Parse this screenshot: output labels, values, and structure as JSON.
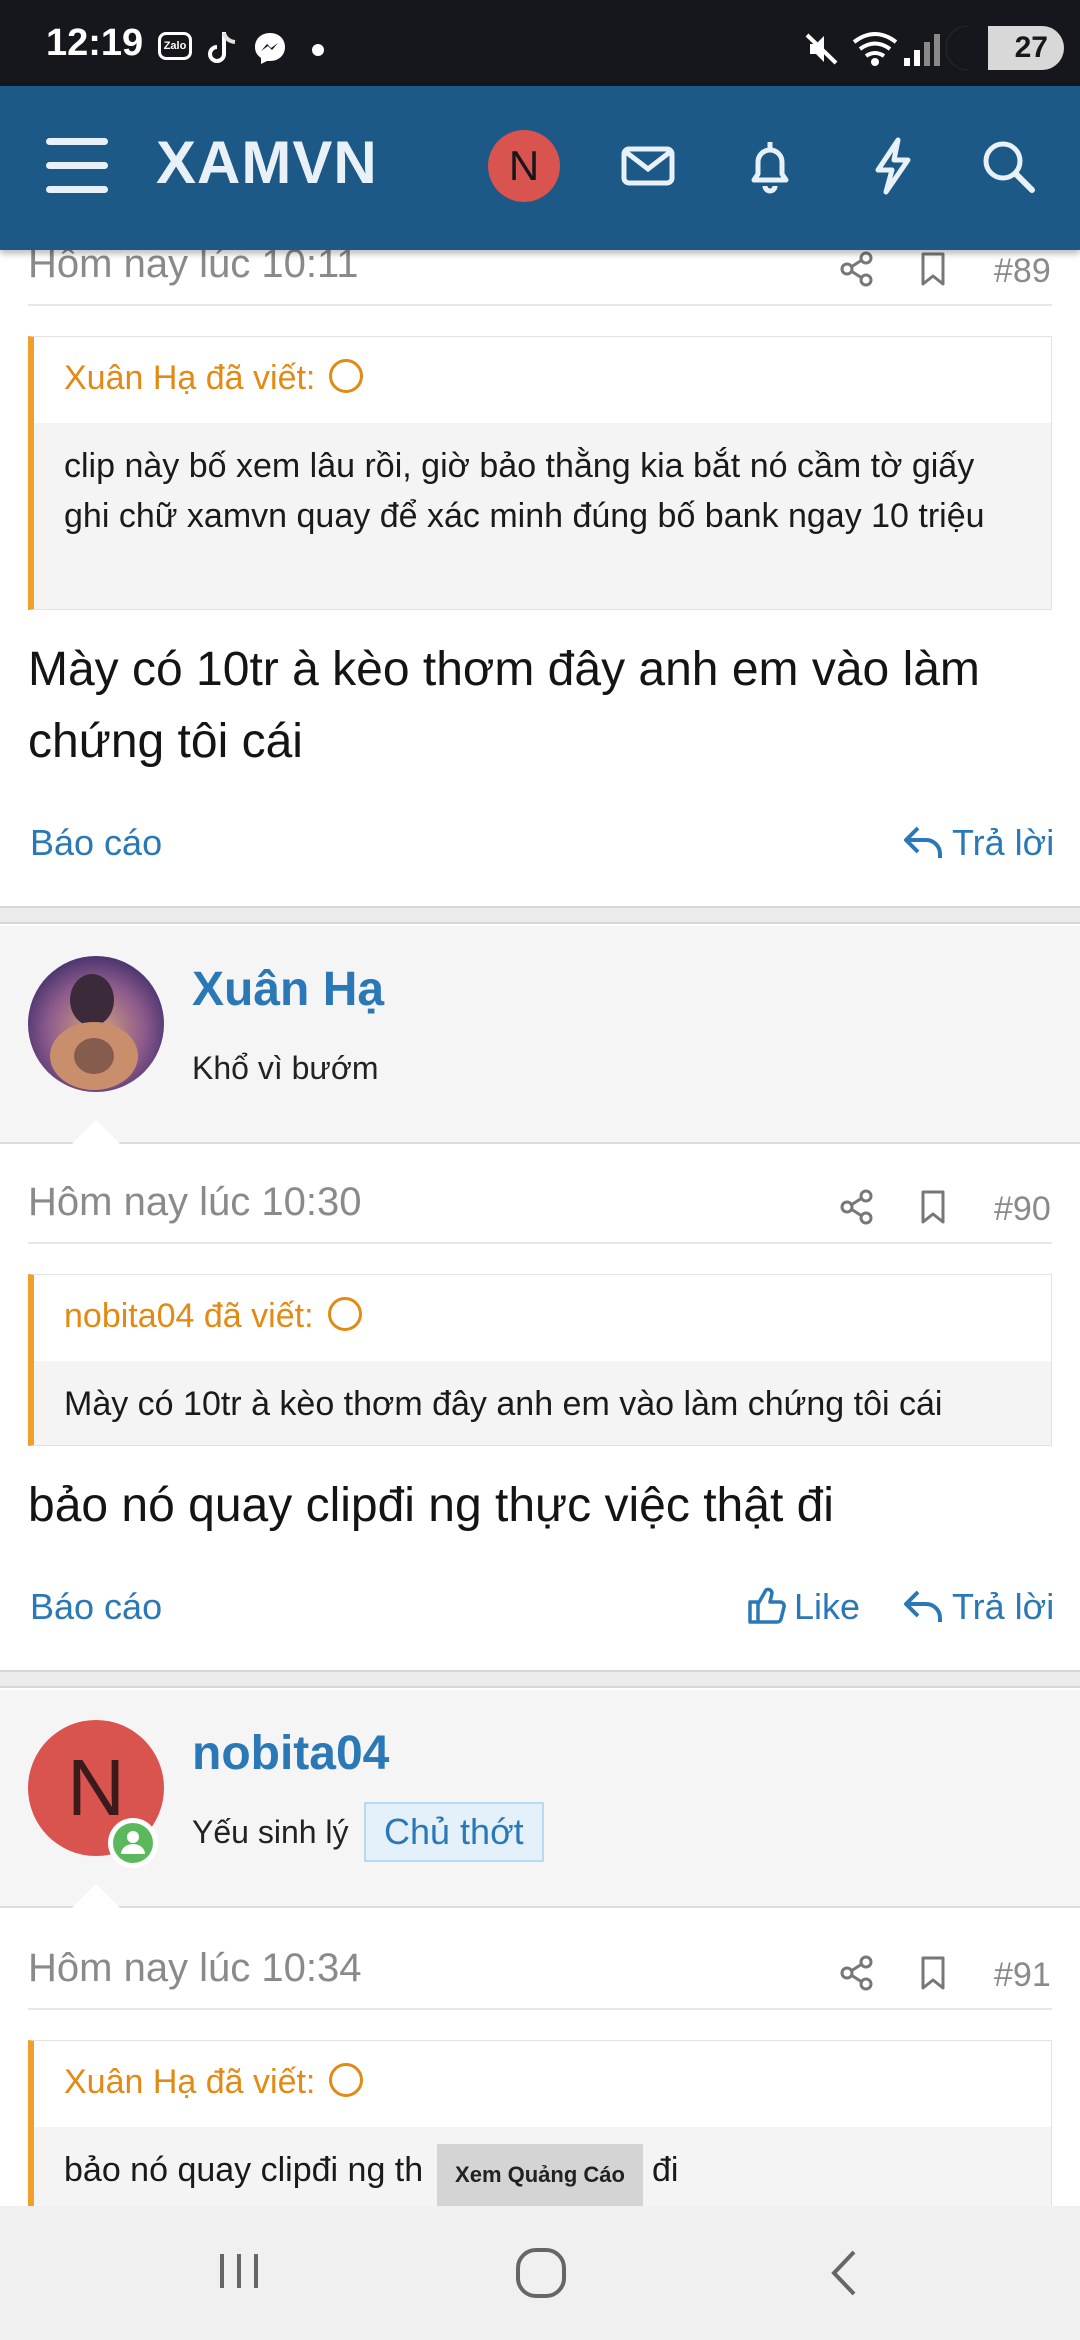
{
  "status_bar": {
    "time": "12:19",
    "zalo_label": "Zalo",
    "battery": "27"
  },
  "header": {
    "brand": "XAMVN",
    "user_initial": "N"
  },
  "posts": [
    {
      "timestamp": "Hôm nay lúc 10:11",
      "number": "#89",
      "quote_author": "Xuân Hạ đã viết:",
      "quote_text": "clip này bố xem lâu rồi, giờ bảo thằng kia bắt nó cầm tờ giấy ghi chữ xamvn quay để xác minh đúng bố bank ngay 10 triệu",
      "message": "Mày có 10tr à kèo thơm đây anh em vào làm chứng tôi cái",
      "report": "Báo cáo",
      "reply": "Trả lời"
    },
    {
      "author": "Xuân Hạ",
      "author_title": "Khổ vì bướm",
      "timestamp": "Hôm nay lúc 10:30",
      "number": "#90",
      "quote_author": "nobita04 đã viết:",
      "quote_text": "Mày có 10tr à kèo thơm đây anh em vào làm chứng tôi cái",
      "message": "bảo nó quay clipđi ng thực việc thật đi",
      "report": "Báo cáo",
      "like": "Like",
      "reply": "Trả lời"
    },
    {
      "author": "nobita04",
      "author_initial": "N",
      "author_title": "Yếu sinh lý",
      "author_badge": "Chủ thớt",
      "timestamp": "Hôm nay lúc 10:34",
      "number": "#91",
      "quote_author": "Xuân Hạ đã viết:",
      "quote_text_start": "bảo nó quay clipđi ng th",
      "quote_text_end": "đi"
    }
  ],
  "ad_button": "Xem Quảng Cáo",
  "colors": {
    "header": "#1c5986",
    "accent": "#2a78b6",
    "quote": "#f0a02a",
    "avatar_n": "#d9534f",
    "online": "#5cb85c"
  }
}
